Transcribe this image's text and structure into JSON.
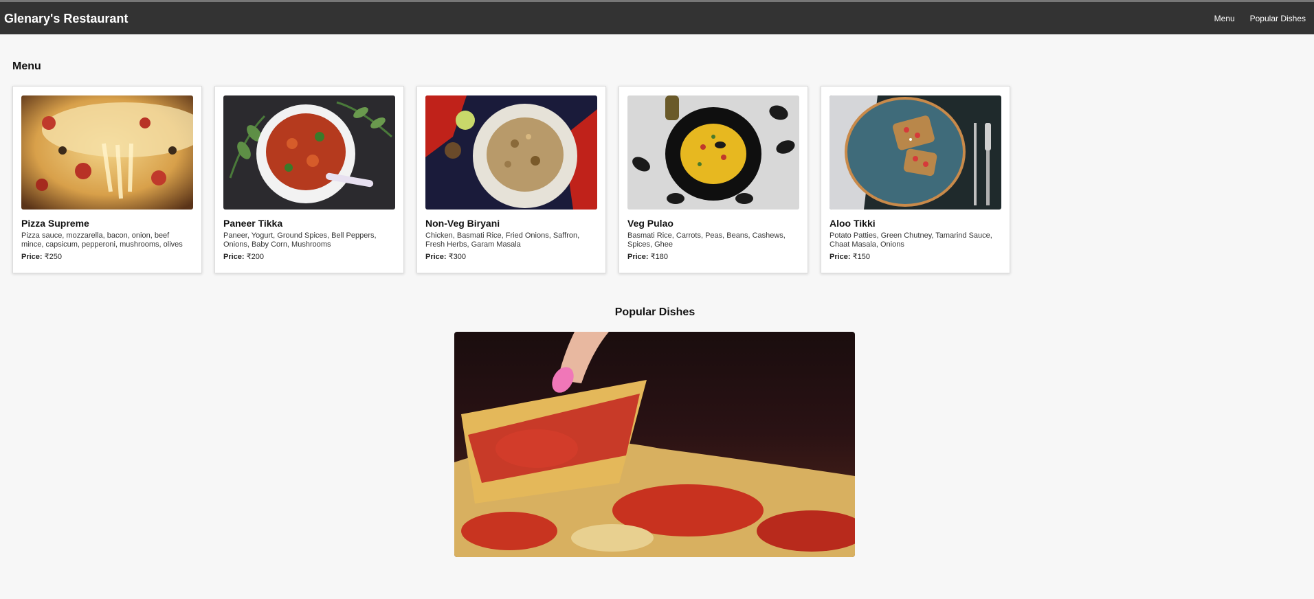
{
  "header": {
    "brand": "Glenary's Restaurant",
    "nav": [
      "Menu",
      "Popular Dishes"
    ]
  },
  "menu": {
    "title": "Menu",
    "price_label": "Price:",
    "items": [
      {
        "name": "Pizza Supreme",
        "desc": "Pizza sauce, mozzarella, bacon, onion, beef mince, capsicum, pepperoni, mushrooms, olives",
        "price": "₹250"
      },
      {
        "name": "Paneer Tikka",
        "desc": "Paneer, Yogurt, Ground Spices, Bell Peppers, Onions, Baby Corn, Mushrooms",
        "price": "₹200"
      },
      {
        "name": "Non-Veg Biryani",
        "desc": "Chicken, Basmati Rice, Fried Onions, Saffron, Fresh Herbs, Garam Masala",
        "price": "₹300"
      },
      {
        "name": "Veg Pulao",
        "desc": "Basmati Rice, Carrots, Peas, Beans, Cashews, Spices, Ghee",
        "price": "₹180"
      },
      {
        "name": "Aloo Tikki",
        "desc": "Potato Patties, Green Chutney, Tamarind Sauce, Chaat Masala, Onions",
        "price": "₹150"
      }
    ]
  },
  "popular": {
    "title": "Popular Dishes"
  },
  "colors": {
    "topbar": "#333333",
    "background": "#f7f7f7"
  }
}
